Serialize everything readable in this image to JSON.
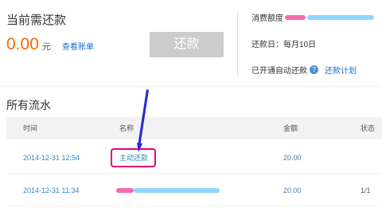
{
  "repay": {
    "label": "当前需还款",
    "amount": "0.00",
    "unit": "元",
    "view_bill": "查看账单",
    "button": "还款"
  },
  "account": {
    "credit_label": "消费额度",
    "repay_day": "还款日：每月10日",
    "auto_repay": "已开通自动还款",
    "help_icon": "?",
    "plan_link": "还款计划"
  },
  "flow": {
    "title": "所有流水",
    "columns": [
      "时间",
      "名称",
      "金额",
      "状态"
    ],
    "rows": [
      {
        "time": "2014-12-31 12:54",
        "name": "主动还款",
        "amount": "20.00",
        "status": ""
      },
      {
        "time": "2014-12-31 11:34",
        "name": "",
        "amount": "20.00",
        "status": "1/1"
      }
    ]
  },
  "annotation": {
    "highlight_color": "#e6007e",
    "arrow_color": "#2a2ad6"
  }
}
